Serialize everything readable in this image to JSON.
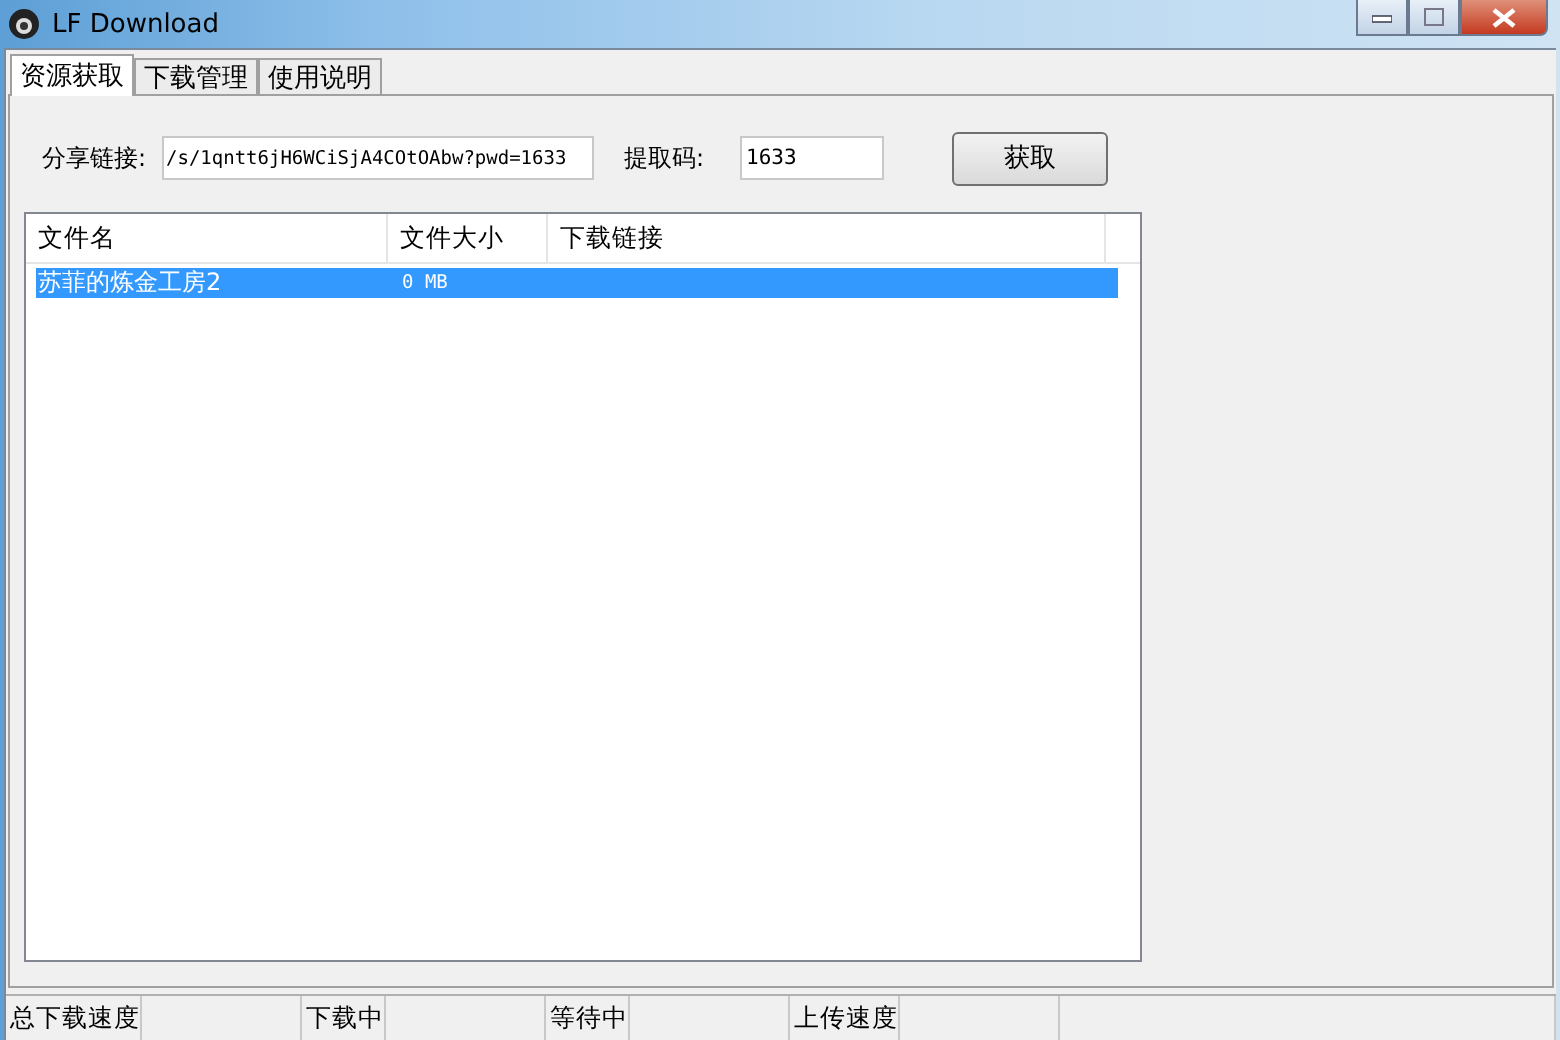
{
  "window": {
    "title": "LF Download"
  },
  "tabs": [
    {
      "label": "资源获取",
      "selected": true
    },
    {
      "label": "下载管理",
      "selected": false
    },
    {
      "label": "使用说明",
      "selected": false
    }
  ],
  "share_link": {
    "label": "分享链接:",
    "value": "/s/1qntt6jH6WCiSjA4COtOAbw?pwd=1633"
  },
  "extract_code": {
    "label": "提取码:",
    "value": "1633"
  },
  "fetch_button": "获取",
  "table": {
    "columns": [
      "文件名",
      "文件大小",
      "下载链接"
    ],
    "rows": [
      {
        "name": "苏菲的炼金工房2",
        "size": "0 MB",
        "selected": true
      }
    ]
  },
  "status_bar": [
    "总下载速度",
    "下载中",
    "等待中",
    "上传速度"
  ]
}
